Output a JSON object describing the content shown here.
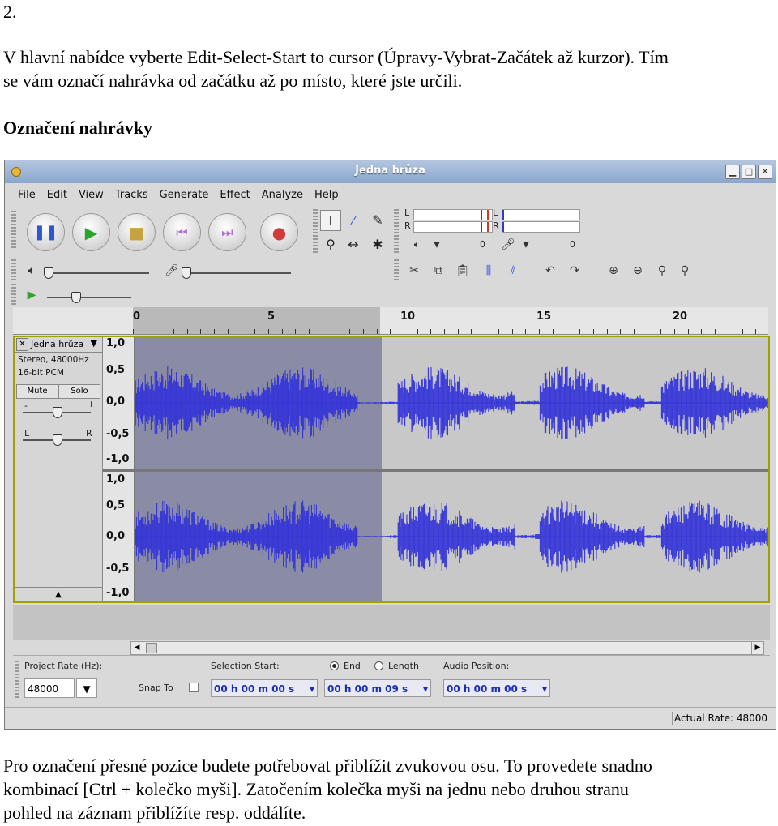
{
  "doc": {
    "heading": "2.",
    "para1_line1": "V hlavní nabídce vyberte Edit-Select-Start to cursor (Úpravy-Vybrat-Začátek až kurzor). Tím",
    "para1_line2": "se vám označí nahrávka od začátku až po místo, které jste určili.",
    "section_title": "Označení nahrávky",
    "para2_line1": "Pro označení přesné pozice budete potřebovat přiblížit zvukovou osu. To provedete snadno",
    "para2_line2": "kombinací [Ctrl + kolečko myši]. Zatočením kolečka myši na jednu nebo druhou stranu",
    "para2_line3": "pohled na záznam přiblížíte resp. oddálíte."
  },
  "app": {
    "title": "Jedna hrůza",
    "menu": [
      "File",
      "Edit",
      "View",
      "Tracks",
      "Generate",
      "Effect",
      "Analyze",
      "Help"
    ],
    "transport_icons": [
      "pause-icon",
      "play-icon",
      "stop-icon",
      "skip-start-icon",
      "skip-end-icon",
      "record-icon"
    ],
    "meter": {
      "L": "L",
      "R": "R",
      "out_zero": "0",
      "in_zero": "0"
    },
    "ruler_labels": [
      "0",
      "5",
      "10",
      "15",
      "20"
    ],
    "track": {
      "name": "Jedna hrůza",
      "format1": "Stereo, 48000Hz",
      "format2": "16-bit PCM",
      "mute": "Mute",
      "solo": "Solo",
      "gain_minus": "-",
      "gain_plus": "+",
      "pan_left": "L",
      "pan_right": "R",
      "collapse": "▲",
      "vscale_ch1": [
        "1,0",
        "0,5",
        "0,0",
        "-0,5",
        "-1,0"
      ],
      "vscale_ch2": [
        "1,0",
        "0,5",
        "0,0",
        "-0,5",
        "-1,0"
      ]
    },
    "selection_bar": {
      "project_rate_label": "Project Rate (Hz):",
      "project_rate": "48000",
      "snap_to": "Snap To",
      "selection_start_label": "Selection Start:",
      "end_label": "End",
      "length_label": "Length",
      "audio_position_label": "Audio Position:",
      "start_time": "00 h 00 m 00 s",
      "end_time": "00 h 00 m 09 s",
      "audio_position": "00 h 00 m 00 s"
    },
    "status": "Actual Rate: 48000"
  },
  "colors": {
    "waveform": "#3434d8",
    "selection": "#8a8ca6",
    "background": "#c8c8c8",
    "title_bar": "#8aa6cc"
  }
}
